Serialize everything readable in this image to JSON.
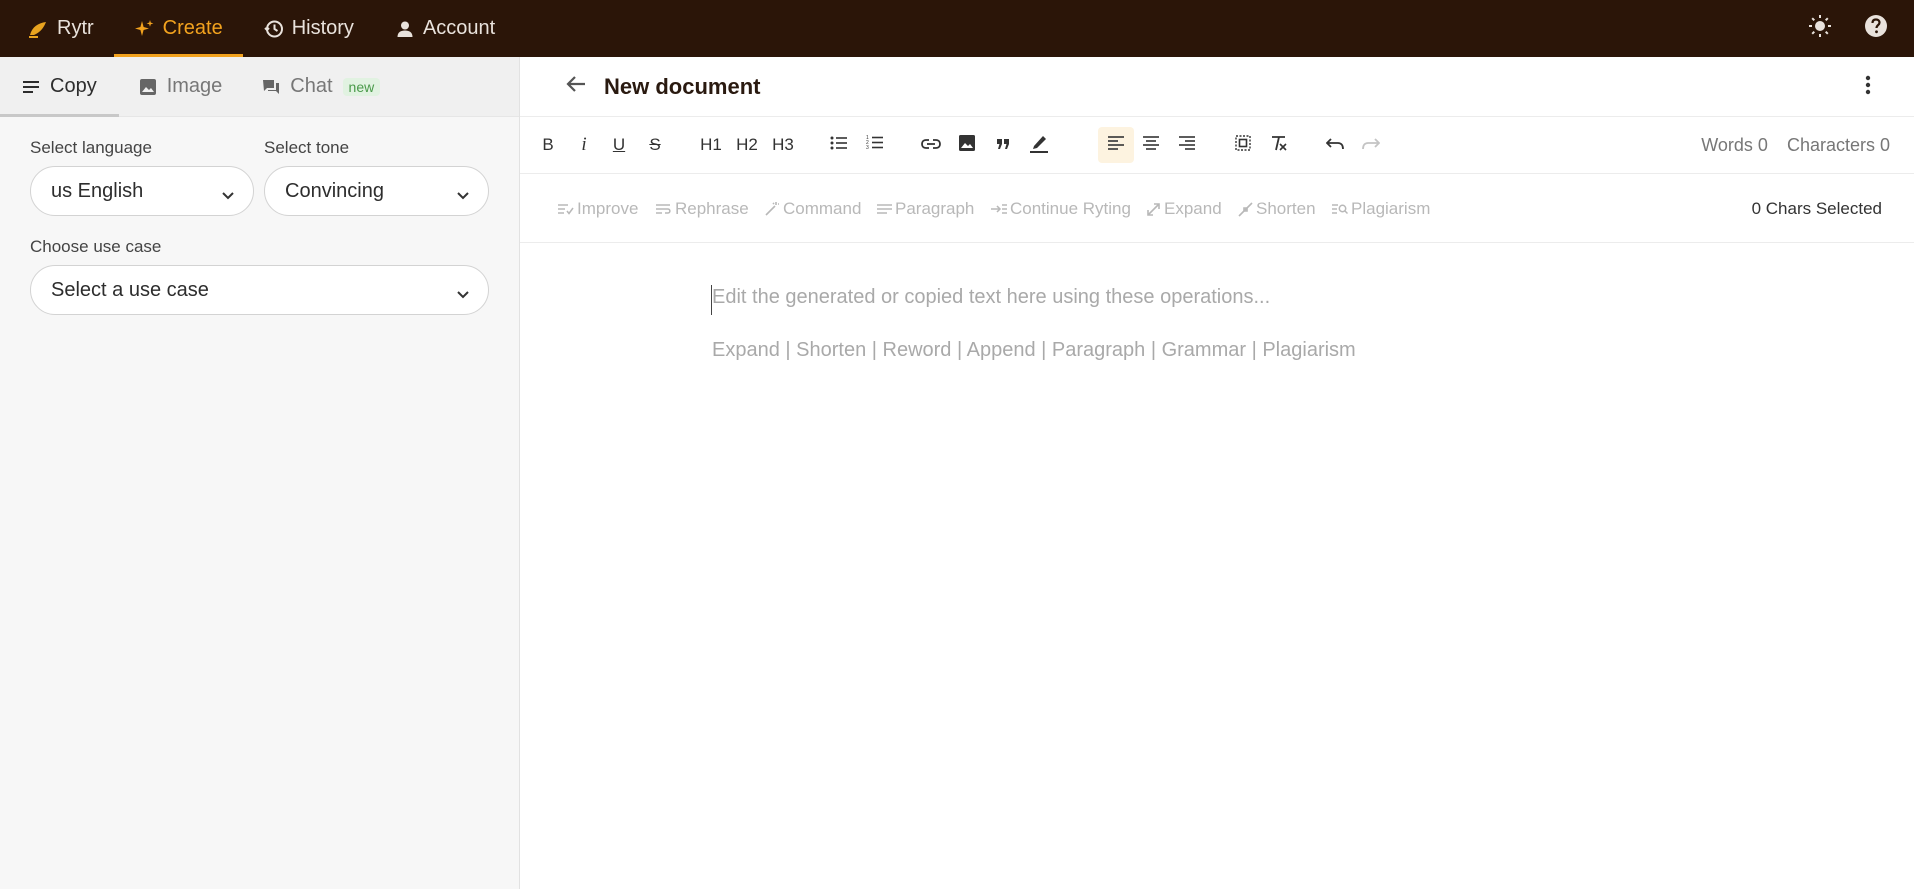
{
  "topnav": {
    "logo_label": "Rytr",
    "items": [
      {
        "label": "Create",
        "icon": "sparkle-icon",
        "active": true
      },
      {
        "label": "History",
        "icon": "history-icon",
        "active": false
      },
      {
        "label": "Account",
        "icon": "user-icon",
        "active": false
      }
    ],
    "right_icons": [
      "sun-icon",
      "help-icon"
    ],
    "accent_color": "#f2a21e",
    "bar_color": "#2b1508"
  },
  "sidebar": {
    "tabs": [
      {
        "label": "Copy",
        "icon": "lines-icon",
        "active": true
      },
      {
        "label": "Image",
        "icon": "image-icon",
        "active": false
      },
      {
        "label": "Chat",
        "icon": "chat-icon",
        "active": false,
        "badge": "new"
      }
    ],
    "language": {
      "label": "Select language",
      "value": "us English"
    },
    "tone": {
      "label": "Select tone",
      "value": "Convincing"
    },
    "use_case": {
      "label": "Choose use case",
      "value": "Select a use case"
    }
  },
  "document": {
    "title": "New document",
    "words_label": "Words 0",
    "characters_label": "Characters 0",
    "toolbar": {
      "bold": "B",
      "italic": "i",
      "underline": "U",
      "strike": "S",
      "h1": "H1",
      "h2": "H2",
      "h3": "H3"
    },
    "ai_actions": [
      {
        "label": "Improve",
        "icon": "improve-icon"
      },
      {
        "label": "Rephrase",
        "icon": "rephrase-icon"
      },
      {
        "label": "Command",
        "icon": "wand-icon"
      },
      {
        "label": "Paragraph",
        "icon": "paragraph-icon"
      },
      {
        "label": "Continue Ryting",
        "icon": "continue-icon"
      },
      {
        "label": "Expand",
        "icon": "expand-icon"
      },
      {
        "label": "Shorten",
        "icon": "shorten-icon"
      },
      {
        "label": "Plagiarism",
        "icon": "plagiarism-icon"
      }
    ],
    "chars_selected": "0 Chars Selected",
    "placeholder": "Edit the generated or copied text here using these operations...",
    "operations_hint": "Expand | Shorten | Reword | Append | Paragraph | Grammar | Plagiarism"
  }
}
